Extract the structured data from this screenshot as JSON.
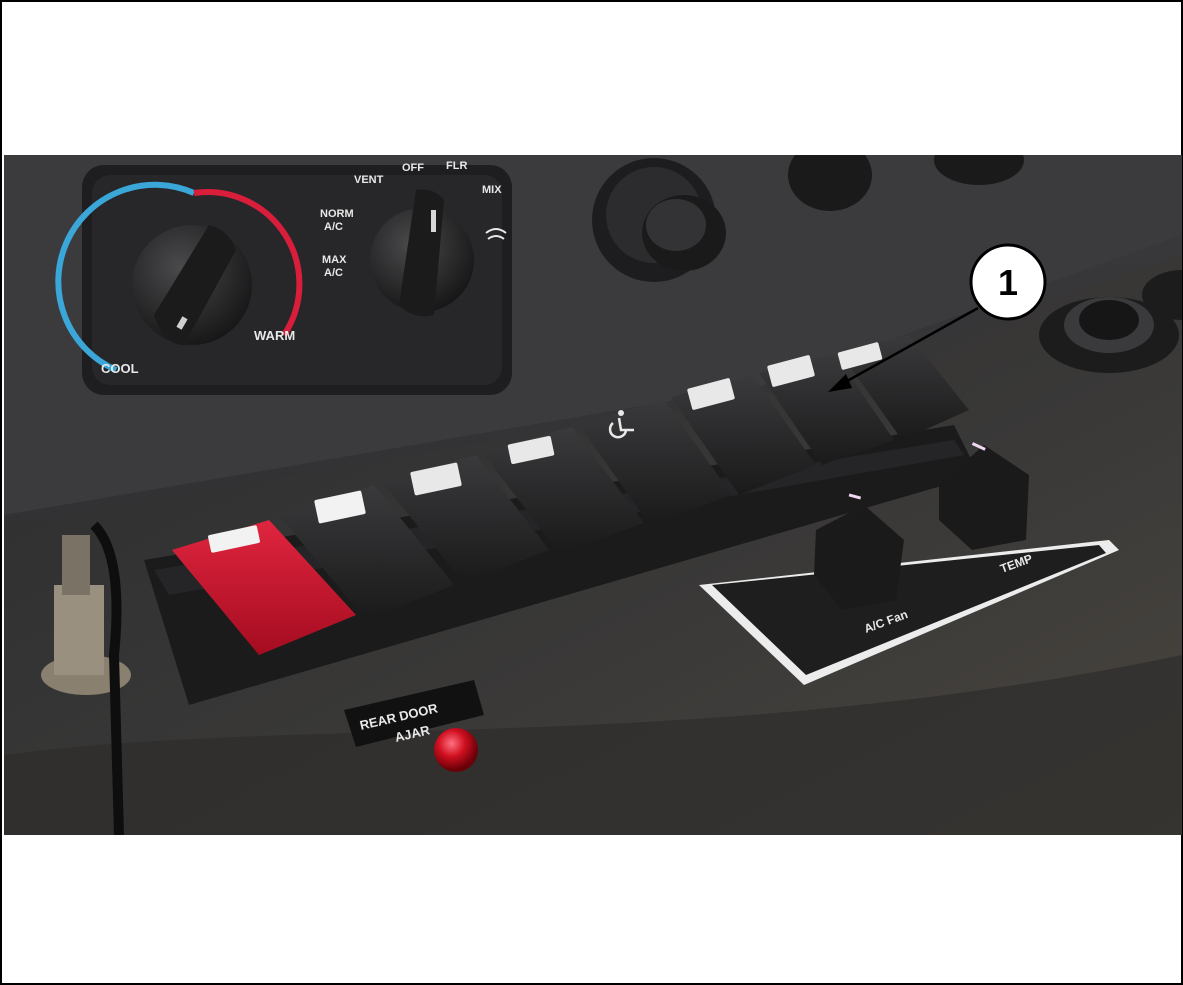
{
  "callout": {
    "number": "1"
  },
  "hvac_panel": {
    "temp_left": "COOL",
    "temp_right": "WARM",
    "mode_vent": "VENT",
    "mode_off": "OFF",
    "mode_flr": "FLR",
    "mode_mix": "MIX",
    "mode_norm": "NORM",
    "mode_norm_ac": "A/C",
    "mode_max": "MAX",
    "mode_max_ac": "A/C"
  },
  "aux_panel": {
    "fan_label": "A/C Fan",
    "temp_label": "TEMP"
  },
  "indicator": {
    "line1": "REAR DOOR",
    "line2": "AJAR"
  },
  "colors": {
    "switch_red": "#c8102e",
    "indicator_light": "#d01020",
    "dial_cool": "#3aa7d8",
    "dial_warm": "#d81e3a"
  }
}
